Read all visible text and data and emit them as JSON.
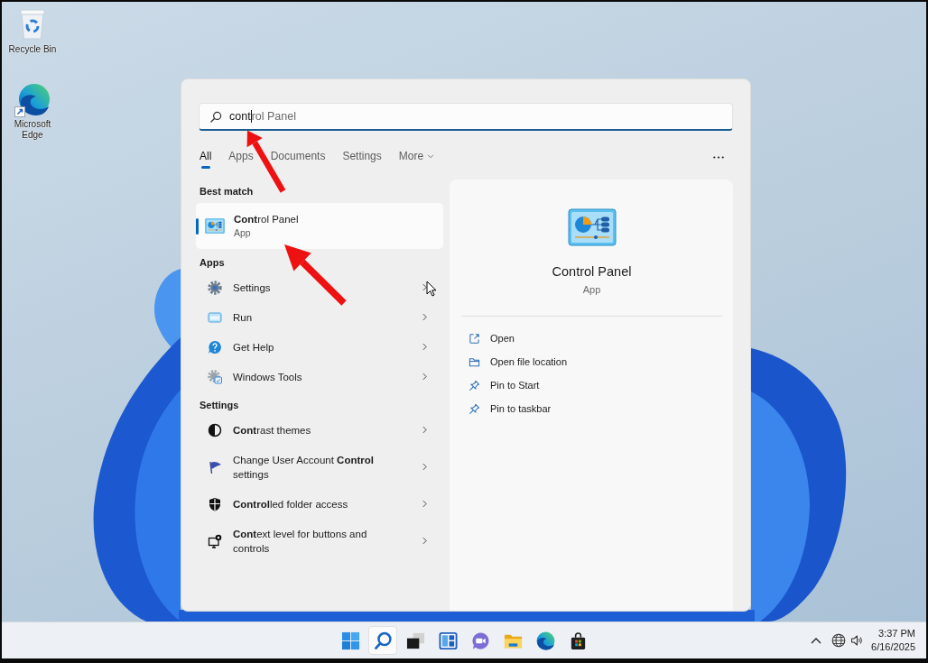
{
  "desktop": {
    "shortcuts": [
      {
        "kind": "recycle-bin",
        "label": "Recycle Bin"
      },
      {
        "kind": "browser",
        "label": "Microsoft Edge"
      }
    ]
  },
  "search_panel": {
    "search": {
      "typed": "cont",
      "suggestion": "rol Panel"
    },
    "tabs": [
      {
        "label": "All",
        "selected": true
      },
      {
        "label": "Apps",
        "selected": false
      },
      {
        "label": "Documents",
        "selected": false
      },
      {
        "label": "Settings",
        "selected": false
      },
      {
        "label": "More",
        "selected": false,
        "dropdown": true
      }
    ],
    "best_match": {
      "heading": "Best match",
      "title": "**Cont**rol Panel",
      "subtitle": "App",
      "selected": true
    },
    "sections": [
      {
        "heading": "Apps",
        "items": [
          {
            "kind": "settings",
            "label": "Settings",
            "selected": false
          },
          {
            "kind": "run",
            "label": "Run",
            "selected": false
          },
          {
            "kind": "help",
            "label": "Get Help",
            "selected": false
          },
          {
            "kind": "tools",
            "label": "Windows Tools",
            "selected": false
          }
        ]
      },
      {
        "heading": "Settings",
        "items": [
          {
            "kind": "contrast",
            "label": "**Cont**rast themes",
            "selected": false
          },
          {
            "kind": "uac",
            "label": "Change User Account **Control** settings",
            "selected": false
          },
          {
            "kind": "shield",
            "label": "**Control**led folder access",
            "selected": false
          },
          {
            "kind": "display",
            "label": "**Cont**ext level for buttons and controls",
            "selected": false
          }
        ]
      }
    ],
    "details": {
      "title": "Control Panel",
      "subtitle": "App",
      "actions": [
        {
          "kind": "open",
          "label": "Open"
        },
        {
          "kind": "folder",
          "label": "Open file location"
        },
        {
          "kind": "pin",
          "label": "Pin to Start"
        },
        {
          "kind": "pin",
          "label": "Pin to taskbar"
        }
      ]
    }
  },
  "taskbar": {
    "apps": [
      {
        "kind": "start",
        "selected": false
      },
      {
        "kind": "search",
        "selected": true
      },
      {
        "kind": "taskview",
        "selected": false
      },
      {
        "kind": "widgets",
        "selected": false
      },
      {
        "kind": "chat",
        "selected": false
      },
      {
        "kind": "explorer",
        "selected": false
      },
      {
        "kind": "browser",
        "selected": false
      },
      {
        "kind": "store",
        "selected": false
      }
    ],
    "clock": {
      "time": "3:37 PM",
      "date": "6/16/2025"
    }
  }
}
